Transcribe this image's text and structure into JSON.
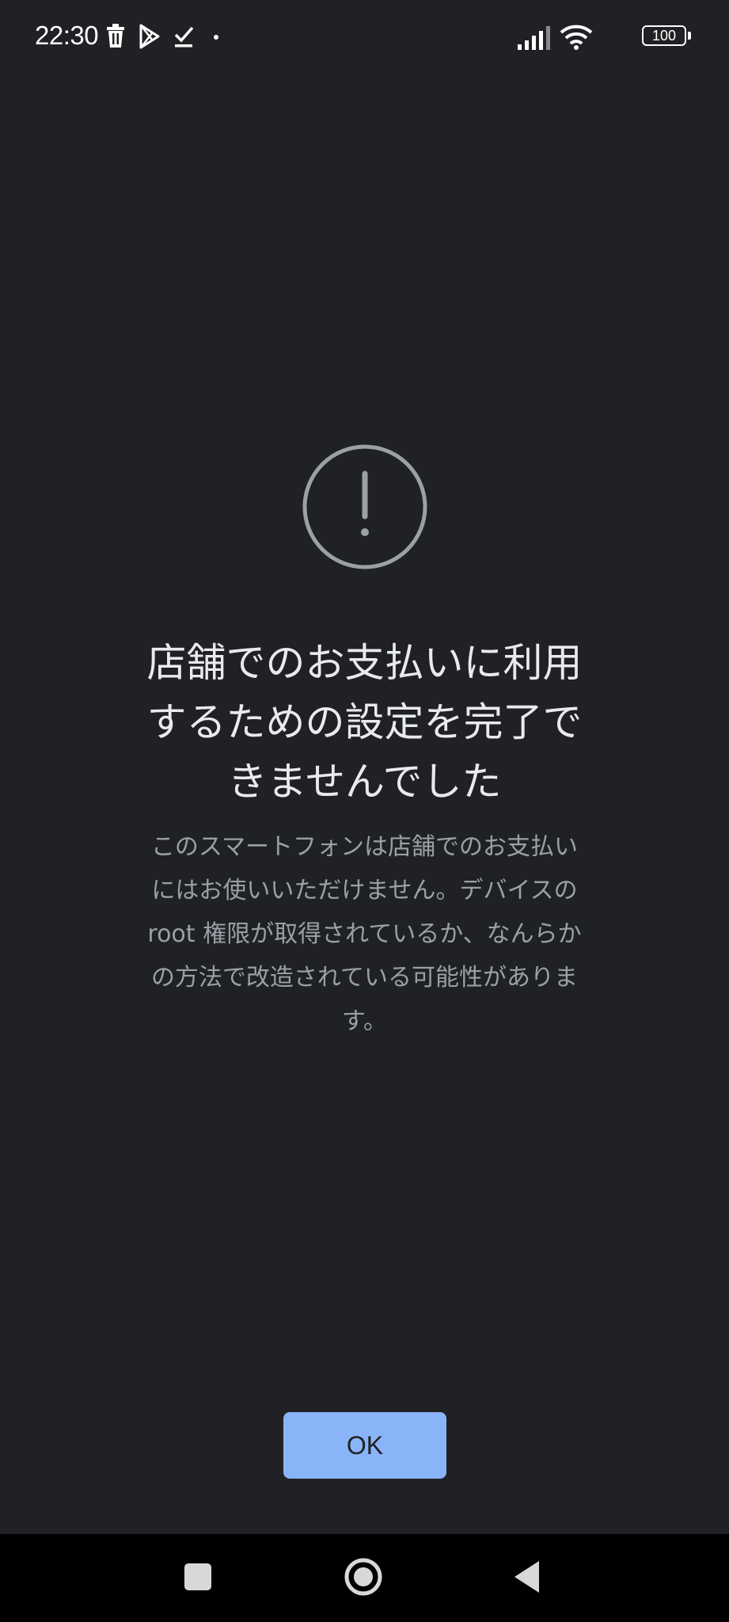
{
  "status_bar": {
    "time": "22:30",
    "left_icons": [
      "trash-icon",
      "play-store-icon",
      "download-done-icon",
      "dot-icon"
    ],
    "right_icons": [
      "signal-icon",
      "wifi-icon",
      "battery-icon"
    ],
    "battery_level": "100"
  },
  "dialog": {
    "icon": "alert-circle-icon",
    "title_lines": [
      "店舗でのお支払いに利用",
      "するための設定を完了で",
      "きませんでした"
    ],
    "message_lines": [
      "このスマートフォンは店舗でのお支払い",
      "にはお使いいただけません。デバイスの",
      "root 権限が取得されているか、なんらか",
      "の方法で改造されている可能性がありま",
      "す。"
    ],
    "ok_label": "OK"
  },
  "nav_bar": {
    "buttons": [
      "recents-square-icon",
      "home-circle-icon",
      "back-triangle-icon"
    ]
  },
  "colors": {
    "background": "#202124",
    "title": "#e8eaed",
    "message": "#9aa0a6",
    "button": "#8ab4f8",
    "nav_bar": "#000000"
  }
}
